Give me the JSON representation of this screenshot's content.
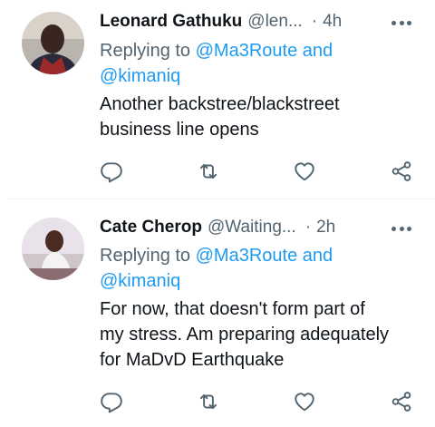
{
  "tweets": [
    {
      "name": "Leonard Gathuku",
      "handle": "@len...",
      "dot": "·",
      "time": "4h",
      "replying_prefix": "Replying to ",
      "mention_1": "@Ma3Route",
      "and_word": " and",
      "mention_2": "@kimaniq",
      "text_line_1": "Another backstree/blackstreet",
      "text_line_2": "business line opens"
    },
    {
      "name": "Cate Cherop",
      "handle": "@Waiting...",
      "dot": "·",
      "time": "2h",
      "replying_prefix": "Replying to ",
      "mention_1": "@Ma3Route",
      "and_word": " and",
      "mention_2": "@kimaniq",
      "text_line_1": "For now, that doesn't form part of",
      "text_line_2": "my stress. Am preparing adequately",
      "text_line_3": "for MaDvD Earthquake"
    }
  ],
  "icons": [
    "more-icon",
    "reply-icon",
    "retweet-icon",
    "like-icon",
    "share-icon"
  ],
  "colors": {
    "text": "#0f1419",
    "secondary": "#536471",
    "link": "#1d9bf0",
    "divider": "#eff3f4"
  }
}
